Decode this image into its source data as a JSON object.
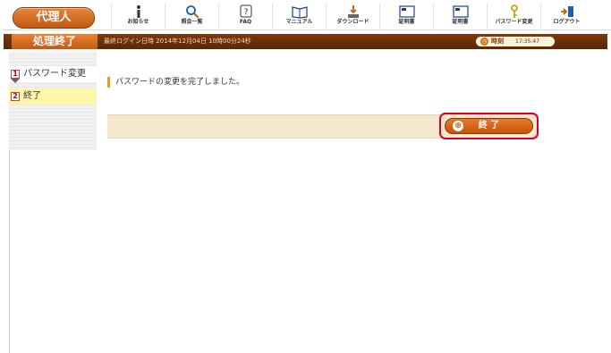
{
  "header": {
    "role_label": "代理人",
    "tools": [
      {
        "label": "お知らせ",
        "icon": "info-icon"
      },
      {
        "label": "照会一覧",
        "icon": "search-icon"
      },
      {
        "label": "FAQ",
        "icon": "faq-icon"
      },
      {
        "label": "マニュアル",
        "icon": "manual-icon"
      },
      {
        "label": "ダウンロード",
        "icon": "download-icon"
      },
      {
        "label": "証明書",
        "icon": "certificate-icon"
      },
      {
        "label": "証明書",
        "icon": "certificate-icon"
      },
      {
        "label": "パスワード変更",
        "icon": "key-icon"
      },
      {
        "label": "ログアウト",
        "icon": "logout-icon"
      }
    ]
  },
  "status": {
    "title": "処理終了",
    "last_login": "最終ログイン日時 2014年12月04日 10時00分24秒",
    "clock_label": "時刻",
    "clock_time": "17:35:47"
  },
  "sidebar": {
    "steps": [
      {
        "num": "1",
        "label": "パスワード変更"
      },
      {
        "num": "2",
        "label": "終了"
      }
    ]
  },
  "main": {
    "message": "パスワードの変更を完了しました。",
    "end_button": "終 了"
  },
  "colors": {
    "brand_orange": "#c9530e",
    "status_bar": "#5a2805",
    "highlight_border": "#d8002a",
    "action_bar": "#f6e8cf"
  }
}
